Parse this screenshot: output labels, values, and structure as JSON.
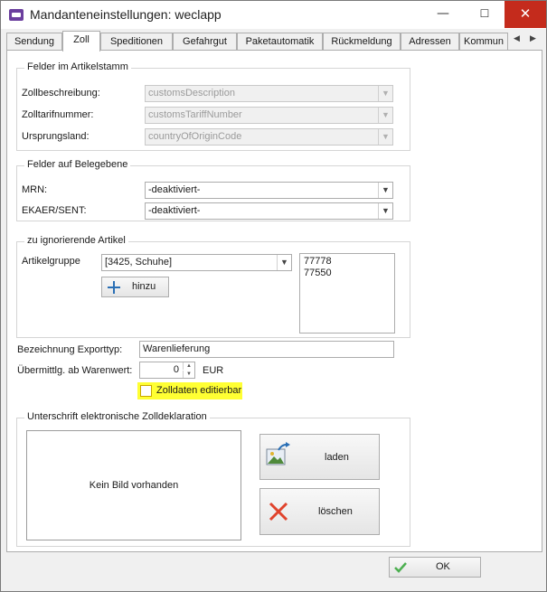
{
  "window": {
    "title": "Mandanteneinstellungen: weclapp",
    "minimize_glyph": "—",
    "maximize_glyph": "☐",
    "close_glyph": "✕"
  },
  "tabs": [
    {
      "label": "Sendung"
    },
    {
      "label": "Zoll",
      "active": true
    },
    {
      "label": "Speditionen"
    },
    {
      "label": "Gefahrgut"
    },
    {
      "label": "Paketautomatik"
    },
    {
      "label": "Rückmeldung"
    },
    {
      "label": "Adressen"
    },
    {
      "label": "Kommun"
    }
  ],
  "tab_scroll": {
    "left": "◀",
    "right": "▶"
  },
  "article_master": {
    "title": "Felder im Artikelstamm",
    "rows": [
      {
        "label": "Zollbeschreibung:",
        "value": "customsDescription"
      },
      {
        "label": "Zolltarifnummer:",
        "value": "customsTariffNumber"
      },
      {
        "label": "Ursprungsland:",
        "value": "countryOfOriginCode"
      }
    ]
  },
  "document_level": {
    "title": "Felder auf Belegebene",
    "rows": [
      {
        "label": "MRN:",
        "value": "-deaktiviert-"
      },
      {
        "label": "EKAER/SENT:",
        "value": "-deaktiviert-"
      }
    ]
  },
  "ignored_articles": {
    "title": "zu ignorierende Artikel",
    "group_label": "Artikelgruppe",
    "group_value": "[3425, Schuhe]",
    "add_label": "hinzu",
    "items": [
      "77778",
      "77550"
    ]
  },
  "export": {
    "type_label": "Bezeichnung Exporttyp:",
    "type_value": "Warenlieferung",
    "threshold_label": "Übermittlg. ab Warenwert:",
    "threshold_value": "0",
    "currency": "EUR",
    "editable_label": "Zolldaten editierbar",
    "editable_checked": false
  },
  "signature": {
    "title": "Unterschrift elektronische Zolldeklaration",
    "placeholder": "Kein Bild vorhanden",
    "load_label": "laden",
    "delete_label": "löschen"
  },
  "footer": {
    "ok_label": "OK"
  },
  "colors": {
    "highlight": "#ffff33",
    "close_red": "#c42b1c",
    "delete_red": "#e0432c",
    "ok_green": "#4caf50",
    "add_blue": "#2a6fb5"
  },
  "glyphs": {
    "dropdown": "▼",
    "spin_up": "▲",
    "spin_down": "▼"
  }
}
